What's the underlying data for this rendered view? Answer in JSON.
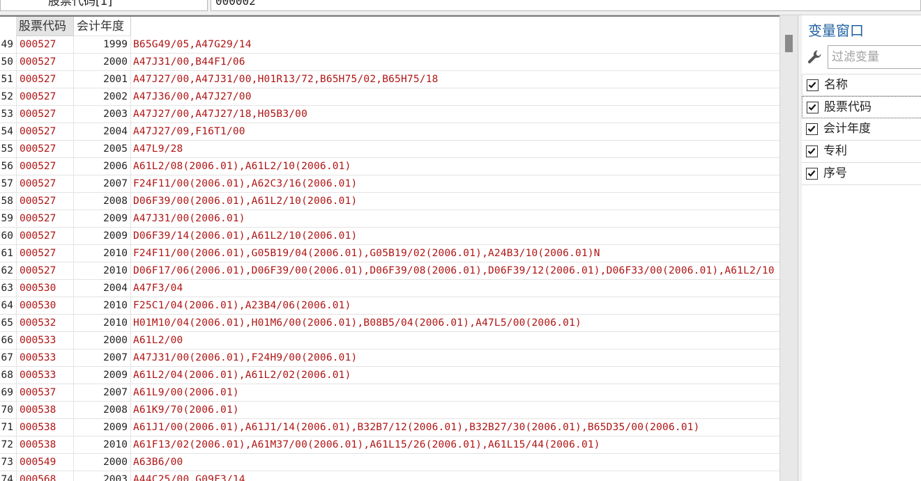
{
  "filter_bar": {
    "field_label": "股票代码[1]",
    "field_value": "000002"
  },
  "grid": {
    "columns": [
      "股票代码",
      "会计年度"
    ],
    "rows": [
      {
        "idx": "49",
        "code": "000527",
        "year": "1999",
        "patent": "B65G49/05,A47G29/14"
      },
      {
        "idx": "50",
        "code": "000527",
        "year": "2000",
        "patent": "A47J31/00,B44F1/06"
      },
      {
        "idx": "51",
        "code": "000527",
        "year": "2001",
        "patent": "A47J27/00,A47J31/00,H01R13/72,B65H75/02,B65H75/18"
      },
      {
        "idx": "52",
        "code": "000527",
        "year": "2002",
        "patent": "A47J36/00,A47J27/00"
      },
      {
        "idx": "53",
        "code": "000527",
        "year": "2003",
        "patent": "A47J27/00,A47J27/18,H05B3/00"
      },
      {
        "idx": "54",
        "code": "000527",
        "year": "2004",
        "patent": "A47J27/09,F16T1/00"
      },
      {
        "idx": "55",
        "code": "000527",
        "year": "2005",
        "patent": "A47L9/28"
      },
      {
        "idx": "56",
        "code": "000527",
        "year": "2006",
        "patent": "A61L2/08(2006.01),A61L2/10(2006.01)"
      },
      {
        "idx": "57",
        "code": "000527",
        "year": "2007",
        "patent": "F24F11/00(2006.01),A62C3/16(2006.01)"
      },
      {
        "idx": "58",
        "code": "000527",
        "year": "2008",
        "patent": "D06F39/00(2006.01),A61L2/10(2006.01)"
      },
      {
        "idx": "59",
        "code": "000527",
        "year": "2009",
        "patent": "A47J31/00(2006.01)"
      },
      {
        "idx": "60",
        "code": "000527",
        "year": "2009",
        "patent": "D06F39/14(2006.01),A61L2/10(2006.01)"
      },
      {
        "idx": "61",
        "code": "000527",
        "year": "2010",
        "patent": "F24F11/00(2006.01),G05B19/04(2006.01),G05B19/02(2006.01),A24B3/10(2006.01)N"
      },
      {
        "idx": "62",
        "code": "000527",
        "year": "2010",
        "patent": "D06F17/06(2006.01),D06F39/00(2006.01),D06F39/08(2006.01),D06F39/12(2006.01),D06F33/00(2006.01),A61L2/10"
      },
      {
        "idx": "63",
        "code": "000530",
        "year": "2004",
        "patent": "A47F3/04"
      },
      {
        "idx": "64",
        "code": "000530",
        "year": "2010",
        "patent": "F25C1/04(2006.01),A23B4/06(2006.01)"
      },
      {
        "idx": "65",
        "code": "000532",
        "year": "2010",
        "patent": "H01M10/04(2006.01),H01M6/00(2006.01),B08B5/04(2006.01),A47L5/00(2006.01)"
      },
      {
        "idx": "66",
        "code": "000533",
        "year": "2000",
        "patent": "A61L2/00"
      },
      {
        "idx": "67",
        "code": "000533",
        "year": "2007",
        "patent": "A47J31/00(2006.01),F24H9/00(2006.01)"
      },
      {
        "idx": "68",
        "code": "000533",
        "year": "2009",
        "patent": "A61L2/04(2006.01),A61L2/02(2006.01)"
      },
      {
        "idx": "69",
        "code": "000537",
        "year": "2007",
        "patent": "A61L9/00(2006.01)"
      },
      {
        "idx": "70",
        "code": "000538",
        "year": "2008",
        "patent": "A61K9/70(2006.01)"
      },
      {
        "idx": "71",
        "code": "000538",
        "year": "2009",
        "patent": "A61J1/00(2006.01),A61J1/14(2006.01),B32B7/12(2006.01),B32B27/30(2006.01),B65D35/00(2006.01)"
      },
      {
        "idx": "72",
        "code": "000538",
        "year": "2010",
        "patent": "A61F13/02(2006.01),A61M37/00(2006.01),A61L15/26(2006.01),A61L15/44(2006.01)"
      },
      {
        "idx": "73",
        "code": "000549",
        "year": "2000",
        "patent": "A63B6/00"
      },
      {
        "idx": "74",
        "code": "000568",
        "year": "2003",
        "patent": "A44C25/00,G09F3/14"
      }
    ]
  },
  "variable_window": {
    "title": "变量窗口",
    "filter_placeholder": "过滤变量",
    "items": [
      {
        "label": "名称",
        "checked": true
      },
      {
        "label": "股票代码",
        "checked": true
      },
      {
        "label": "会计年度",
        "checked": true
      },
      {
        "label": "专利",
        "checked": true
      },
      {
        "label": "序号",
        "checked": true
      }
    ]
  },
  "colors": {
    "data_text": "#b01414",
    "panel_title": "#1e5fa0"
  }
}
